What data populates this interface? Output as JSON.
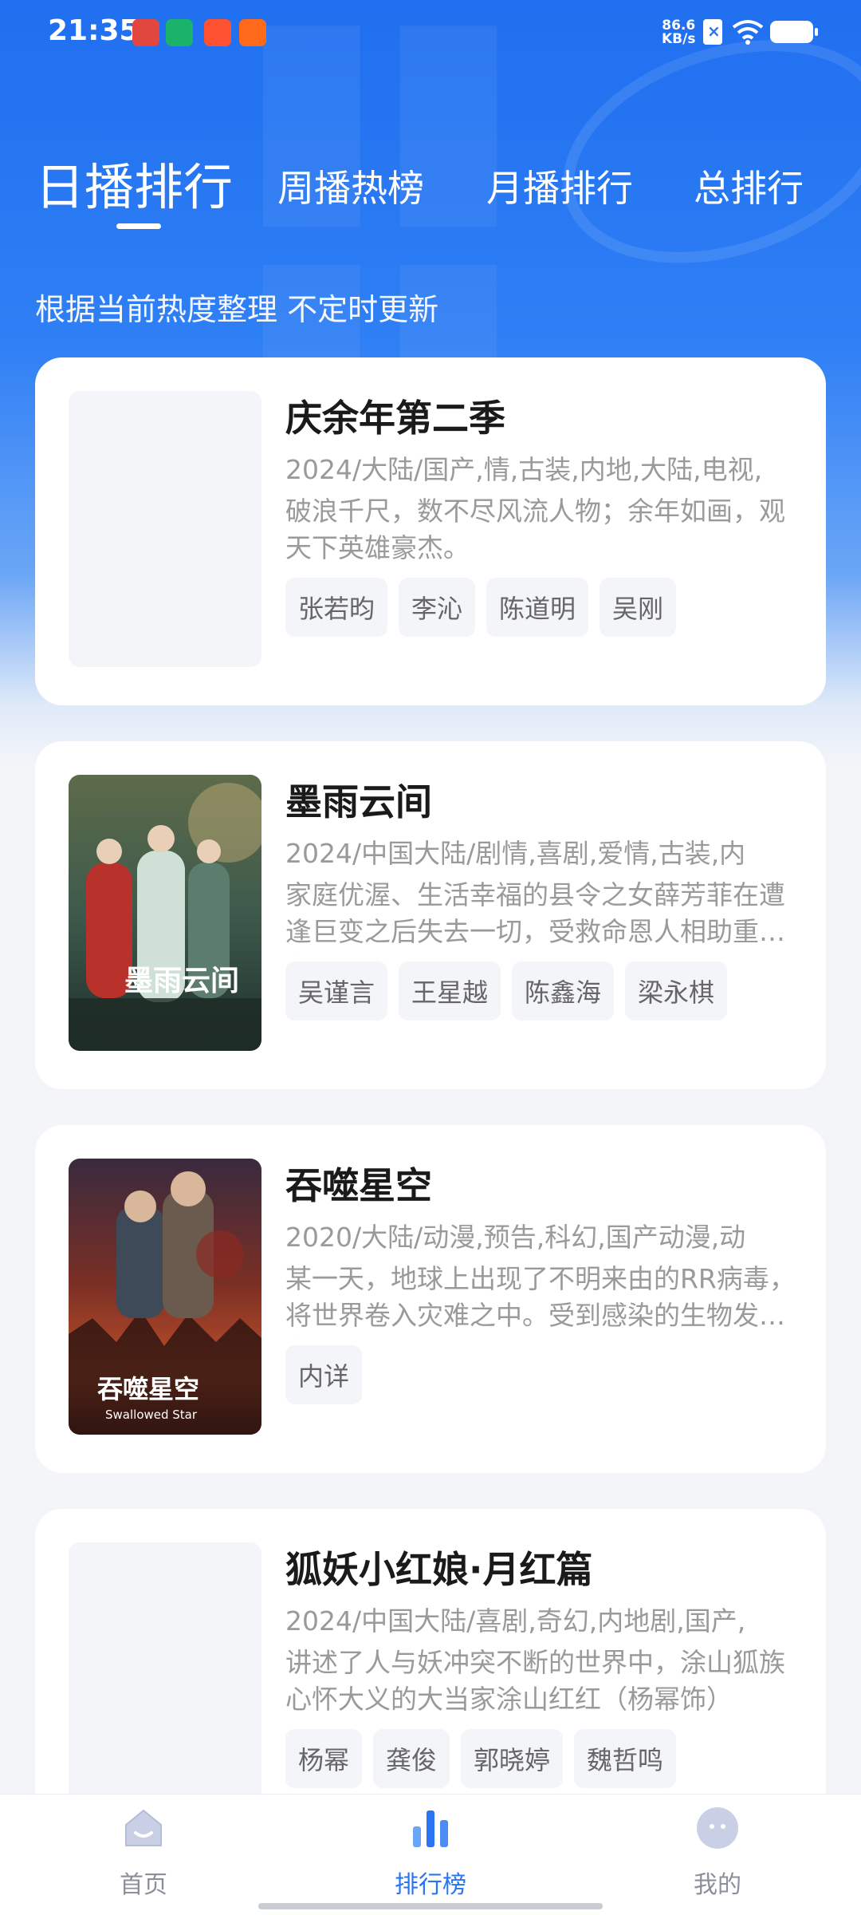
{
  "status_bar": {
    "time": "21:35",
    "net_speed": "86.6",
    "net_unit": "KB/s"
  },
  "tabs": [
    {
      "label": "日播排行",
      "active": true
    },
    {
      "label": "周播热榜",
      "active": false
    },
    {
      "label": "月播排行",
      "active": false
    },
    {
      "label": "总排行",
      "active": false
    }
  ],
  "subtitle": "根据当前热度整理 不定时更新",
  "items": [
    {
      "title": "庆余年第二季",
      "meta": "2024/大陆/国产,情,古装,内地,大陆,电视,",
      "desc": "破浪千尺，数不尽风流人物；余年如画，观天下英雄豪杰。",
      "tags": [
        "张若昀",
        "李沁",
        "陈道明",
        "吴刚"
      ]
    },
    {
      "title": "墨雨云间",
      "meta": "2024/中国大陆/剧情,喜剧,爱情,古装,内",
      "desc": "家庭优渥、生活幸福的县令之女薛芳菲在遭逢巨变之后失去一切，受救命恩人相助重返京城",
      "tags": [
        "吴谨言",
        "王星越",
        "陈鑫海",
        "梁永棋"
      ],
      "poster_text": "墨雨云间"
    },
    {
      "title": "吞噬星空",
      "meta": "2020/大陆/动漫,预告,科幻,国产动漫,动",
      "desc": "某一天，地球上出现了不明来由的RR病毒，将世界卷入灾难之中。受到感染的生物发生变异",
      "tags": [
        "内详"
      ],
      "poster_text": "吞噬星空",
      "poster_sub": "Swallowed Star"
    },
    {
      "title": "狐妖小红娘·月红篇",
      "meta": "2024/中国大陆/喜剧,奇幻,内地剧,国产,",
      "desc": "讲述了人与妖冲突不断的世界中，涂山狐族心怀大义的大当家涂山红红（杨幂饰）",
      "tags": [
        "杨幂",
        "龚俊",
        "郭晓婷",
        "魏哲鸣"
      ]
    }
  ],
  "bottom_nav": [
    {
      "label": "首页",
      "icon": "home-icon",
      "active": false
    },
    {
      "label": "排行榜",
      "icon": "chart-icon",
      "active": true
    },
    {
      "label": "我的",
      "icon": "profile-icon",
      "active": false
    }
  ],
  "colors": {
    "accent": "#2a74f2",
    "hero_top": "#1f6ff0",
    "background": "#f3f5f9"
  }
}
